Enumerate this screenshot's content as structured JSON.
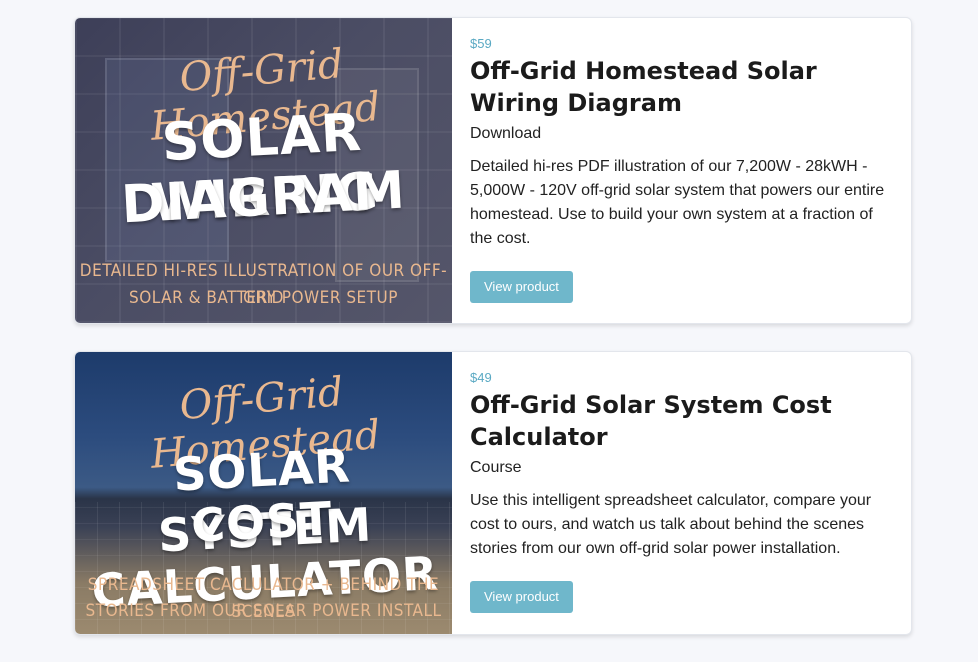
{
  "products": [
    {
      "price": "$59",
      "title": "Off-Grid Homestead Solar Wiring Diagram",
      "type": "Download",
      "description": "Detailed hi-res PDF illustration of our 7,200W - 28kWH - 5,000W - 120V off-grid solar system that powers our entire homestead. Use to build your own system at a fraction of the cost.",
      "button_label": "View product",
      "image": {
        "script_text": "Off-Grid Homestead",
        "headline_line1": "SOLAR WIRING",
        "headline_line2": "DIAGRAM",
        "subtitle_line1": "DETAILED HI-RES ILLUSTRATION OF OUR OFF-GRID",
        "subtitle_line2": "SOLAR & BATTERY POWER SETUP"
      }
    },
    {
      "price": "$49",
      "title": "Off-Grid Solar System Cost Calculator",
      "type": "Course",
      "description": "Use this intelligent spreadsheet calculator, compare your cost to ours, and watch us talk about behind the scenes stories from our own off-grid solar power installation.",
      "button_label": "View product",
      "image": {
        "script_text": "Off-Grid Homestead",
        "headline_line1": "SOLAR SYSTEM",
        "headline_line2": "COST CALCULATOR",
        "subtitle_line1": "SPREADSHEET CACLULATOR + BEHIND THE SCENES",
        "subtitle_line2": "STORIES FROM OUR SOLAR POWER INSTALL"
      }
    }
  ],
  "colors": {
    "accent": "#6fb7cb",
    "price": "#5aa9c3",
    "thumb_text_accent": "#e9b88f"
  }
}
